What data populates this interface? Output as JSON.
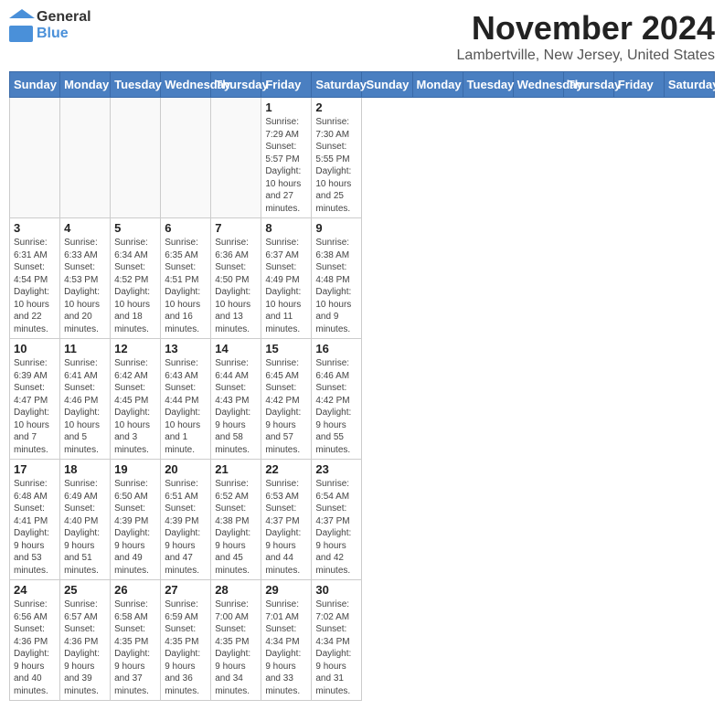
{
  "header": {
    "logo_line1": "General",
    "logo_line2": "Blue",
    "month_title": "November 2024",
    "location": "Lambertville, New Jersey, United States"
  },
  "days_of_week": [
    "Sunday",
    "Monday",
    "Tuesday",
    "Wednesday",
    "Thursday",
    "Friday",
    "Saturday"
  ],
  "weeks": [
    [
      {
        "day": "",
        "info": ""
      },
      {
        "day": "",
        "info": ""
      },
      {
        "day": "",
        "info": ""
      },
      {
        "day": "",
        "info": ""
      },
      {
        "day": "",
        "info": ""
      },
      {
        "day": "1",
        "info": "Sunrise: 7:29 AM\nSunset: 5:57 PM\nDaylight: 10 hours and 27 minutes."
      },
      {
        "day": "2",
        "info": "Sunrise: 7:30 AM\nSunset: 5:55 PM\nDaylight: 10 hours and 25 minutes."
      }
    ],
    [
      {
        "day": "3",
        "info": "Sunrise: 6:31 AM\nSunset: 4:54 PM\nDaylight: 10 hours and 22 minutes."
      },
      {
        "day": "4",
        "info": "Sunrise: 6:33 AM\nSunset: 4:53 PM\nDaylight: 10 hours and 20 minutes."
      },
      {
        "day": "5",
        "info": "Sunrise: 6:34 AM\nSunset: 4:52 PM\nDaylight: 10 hours and 18 minutes."
      },
      {
        "day": "6",
        "info": "Sunrise: 6:35 AM\nSunset: 4:51 PM\nDaylight: 10 hours and 16 minutes."
      },
      {
        "day": "7",
        "info": "Sunrise: 6:36 AM\nSunset: 4:50 PM\nDaylight: 10 hours and 13 minutes."
      },
      {
        "day": "8",
        "info": "Sunrise: 6:37 AM\nSunset: 4:49 PM\nDaylight: 10 hours and 11 minutes."
      },
      {
        "day": "9",
        "info": "Sunrise: 6:38 AM\nSunset: 4:48 PM\nDaylight: 10 hours and 9 minutes."
      }
    ],
    [
      {
        "day": "10",
        "info": "Sunrise: 6:39 AM\nSunset: 4:47 PM\nDaylight: 10 hours and 7 minutes."
      },
      {
        "day": "11",
        "info": "Sunrise: 6:41 AM\nSunset: 4:46 PM\nDaylight: 10 hours and 5 minutes."
      },
      {
        "day": "12",
        "info": "Sunrise: 6:42 AM\nSunset: 4:45 PM\nDaylight: 10 hours and 3 minutes."
      },
      {
        "day": "13",
        "info": "Sunrise: 6:43 AM\nSunset: 4:44 PM\nDaylight: 10 hours and 1 minute."
      },
      {
        "day": "14",
        "info": "Sunrise: 6:44 AM\nSunset: 4:43 PM\nDaylight: 9 hours and 58 minutes."
      },
      {
        "day": "15",
        "info": "Sunrise: 6:45 AM\nSunset: 4:42 PM\nDaylight: 9 hours and 57 minutes."
      },
      {
        "day": "16",
        "info": "Sunrise: 6:46 AM\nSunset: 4:42 PM\nDaylight: 9 hours and 55 minutes."
      }
    ],
    [
      {
        "day": "17",
        "info": "Sunrise: 6:48 AM\nSunset: 4:41 PM\nDaylight: 9 hours and 53 minutes."
      },
      {
        "day": "18",
        "info": "Sunrise: 6:49 AM\nSunset: 4:40 PM\nDaylight: 9 hours and 51 minutes."
      },
      {
        "day": "19",
        "info": "Sunrise: 6:50 AM\nSunset: 4:39 PM\nDaylight: 9 hours and 49 minutes."
      },
      {
        "day": "20",
        "info": "Sunrise: 6:51 AM\nSunset: 4:39 PM\nDaylight: 9 hours and 47 minutes."
      },
      {
        "day": "21",
        "info": "Sunrise: 6:52 AM\nSunset: 4:38 PM\nDaylight: 9 hours and 45 minutes."
      },
      {
        "day": "22",
        "info": "Sunrise: 6:53 AM\nSunset: 4:37 PM\nDaylight: 9 hours and 44 minutes."
      },
      {
        "day": "23",
        "info": "Sunrise: 6:54 AM\nSunset: 4:37 PM\nDaylight: 9 hours and 42 minutes."
      }
    ],
    [
      {
        "day": "24",
        "info": "Sunrise: 6:56 AM\nSunset: 4:36 PM\nDaylight: 9 hours and 40 minutes."
      },
      {
        "day": "25",
        "info": "Sunrise: 6:57 AM\nSunset: 4:36 PM\nDaylight: 9 hours and 39 minutes."
      },
      {
        "day": "26",
        "info": "Sunrise: 6:58 AM\nSunset: 4:35 PM\nDaylight: 9 hours and 37 minutes."
      },
      {
        "day": "27",
        "info": "Sunrise: 6:59 AM\nSunset: 4:35 PM\nDaylight: 9 hours and 36 minutes."
      },
      {
        "day": "28",
        "info": "Sunrise: 7:00 AM\nSunset: 4:35 PM\nDaylight: 9 hours and 34 minutes."
      },
      {
        "day": "29",
        "info": "Sunrise: 7:01 AM\nSunset: 4:34 PM\nDaylight: 9 hours and 33 minutes."
      },
      {
        "day": "30",
        "info": "Sunrise: 7:02 AM\nSunset: 4:34 PM\nDaylight: 9 hours and 31 minutes."
      }
    ]
  ]
}
